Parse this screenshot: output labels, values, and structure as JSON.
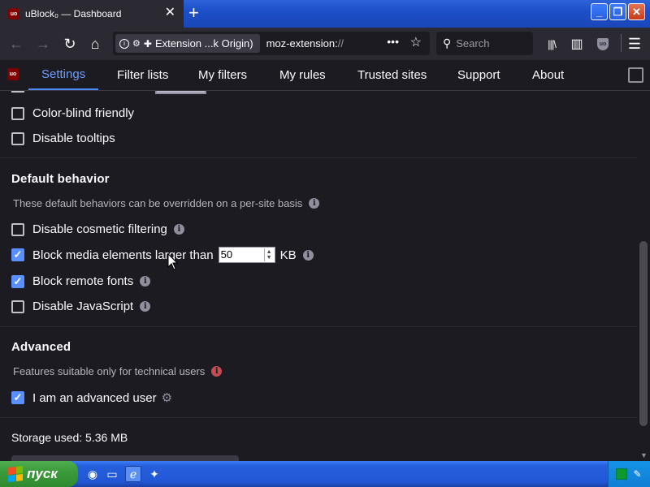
{
  "window": {
    "tab_title": "uBlock₀ — Dashboard",
    "tab_favicon": "uo",
    "tab_close": "✕",
    "new_tab": "+",
    "minimize": "_",
    "maximize": "❐",
    "close": "✕"
  },
  "toolbar": {
    "back": "←",
    "forward": "→",
    "reload": "↻",
    "home": "⌂",
    "identity_label": "Extension ...k Origin)",
    "url_prefix": "moz-extension:",
    "url_suffix": "//",
    "page_actions": "•••",
    "bookmark": "☆",
    "search_placeholder": "Search",
    "library": "|||\\",
    "sidebar": "▥",
    "ublock_badge": "uo",
    "menu": "☰"
  },
  "dashboard": {
    "logo": "uo",
    "tabs": [
      {
        "label": "Settings",
        "active": true
      },
      {
        "label": "Filter lists",
        "active": false
      },
      {
        "label": "My filters",
        "active": false
      },
      {
        "label": "My rules",
        "active": false
      },
      {
        "label": "Trusted sites",
        "active": false
      },
      {
        "label": "Support",
        "active": false
      },
      {
        "label": "About",
        "active": false
      }
    ]
  },
  "appearance": {
    "color_blind": {
      "label": "Color-blind friendly",
      "checked": false
    },
    "disable_tooltips": {
      "label": "Disable tooltips",
      "checked": false
    }
  },
  "default_behavior": {
    "heading": "Default behavior",
    "description": "These default behaviors can be overridden on a per-site basis",
    "disable_cosmetic": {
      "label": "Disable cosmetic filtering",
      "checked": false
    },
    "block_media": {
      "label": "Block media elements larger than",
      "checked": true,
      "value": "50",
      "unit": "KB"
    },
    "block_fonts": {
      "label": "Block remote fonts",
      "checked": true
    },
    "disable_js": {
      "label": "Disable JavaScript",
      "checked": false
    }
  },
  "advanced": {
    "heading": "Advanced",
    "description": "Features suitable only for technical users",
    "advanced_user": {
      "label": "I am an advanced user",
      "checked": true
    }
  },
  "storage": {
    "label": "Storage used: 5.36 MB"
  },
  "taskbar": {
    "start_label": "пуск"
  },
  "colors": {
    "accent": "#4c8dff",
    "checkbox_on": "#5a8fff",
    "background": "#1c1b22",
    "chrome": "#2b2a33",
    "warning_info": "#c24e54"
  }
}
